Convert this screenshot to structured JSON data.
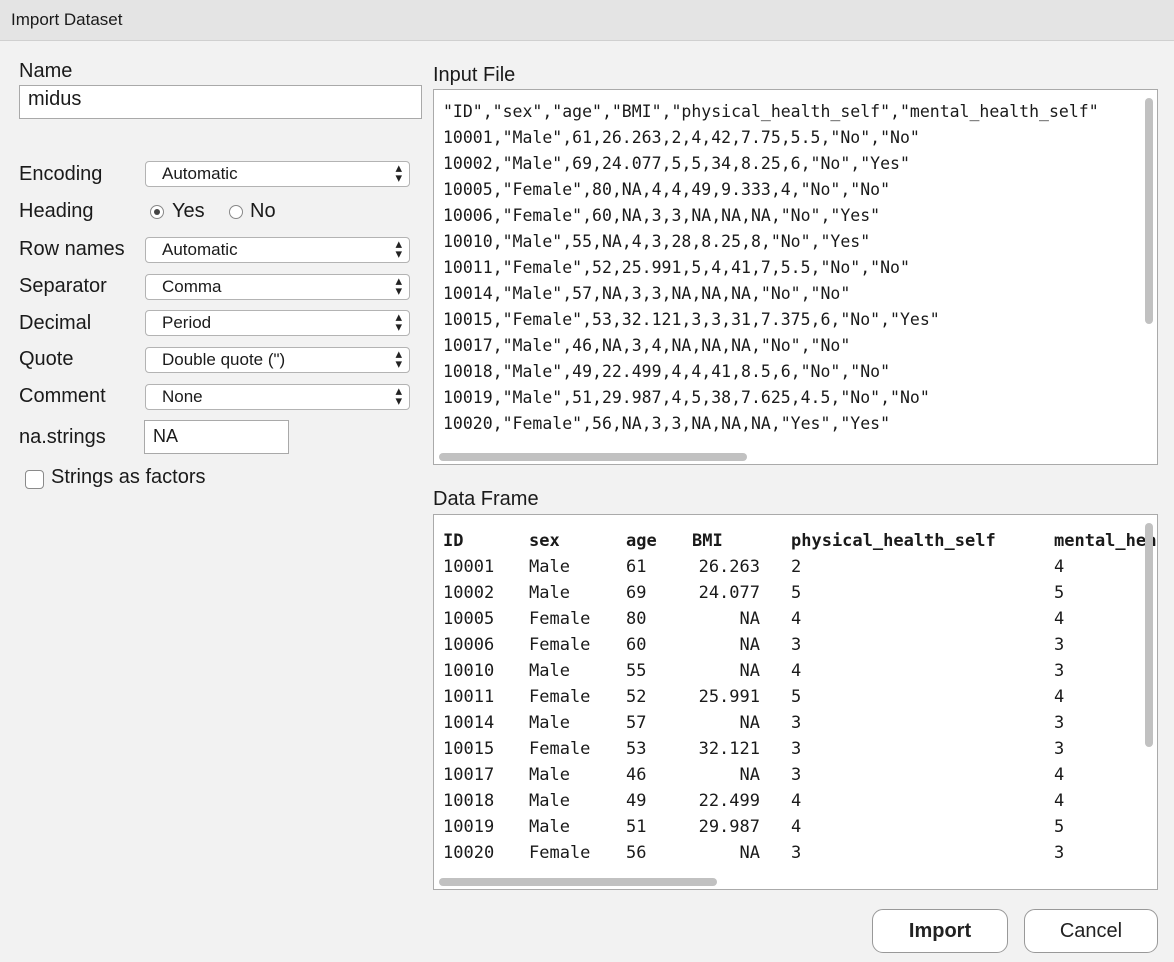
{
  "window": {
    "title": "Import Dataset"
  },
  "name": {
    "label": "Name",
    "value": "midus"
  },
  "options": {
    "encoding": {
      "label": "Encoding",
      "value": "Automatic"
    },
    "heading": {
      "label": "Heading",
      "yes": "Yes",
      "no": "No",
      "selected": "Yes"
    },
    "row_names": {
      "label": "Row names",
      "value": "Automatic"
    },
    "separator": {
      "label": "Separator",
      "value": "Comma"
    },
    "decimal": {
      "label": "Decimal",
      "value": "Period"
    },
    "quote": {
      "label": "Quote",
      "value": "Double quote (\")"
    },
    "comment": {
      "label": "Comment",
      "value": "None"
    },
    "na_strings": {
      "label": "na.strings",
      "value": "NA"
    },
    "strings_as_factors": {
      "label": "Strings as factors",
      "checked": false
    }
  },
  "input_file": {
    "label": "Input File",
    "lines": [
      "\"ID\",\"sex\",\"age\",\"BMI\",\"physical_health_self\",\"mental_health_self\"",
      "10001,\"Male\",61,26.263,2,4,42,7.75,5.5,\"No\",\"No\"",
      "10002,\"Male\",69,24.077,5,5,34,8.25,6,\"No\",\"Yes\"",
      "10005,\"Female\",80,NA,4,4,49,9.333,4,\"No\",\"No\"",
      "10006,\"Female\",60,NA,3,3,NA,NA,NA,\"No\",\"Yes\"",
      "10010,\"Male\",55,NA,4,3,28,8.25,8,\"No\",\"Yes\"",
      "10011,\"Female\",52,25.991,5,4,41,7,5.5,\"No\",\"No\"",
      "10014,\"Male\",57,NA,3,3,NA,NA,NA,\"No\",\"No\"",
      "10015,\"Female\",53,32.121,3,3,31,7.375,6,\"No\",\"Yes\"",
      "10017,\"Male\",46,NA,3,4,NA,NA,NA,\"No\",\"No\"",
      "10018,\"Male\",49,22.499,4,4,41,8.5,6,\"No\",\"No\"",
      "10019,\"Male\",51,29.987,4,5,38,7.625,4.5,\"No\",\"No\"",
      "10020,\"Female\",56,NA,3,3,NA,NA,NA,\"Yes\",\"Yes\""
    ]
  },
  "data_frame": {
    "label": "Data Frame",
    "columns": [
      "ID",
      "sex",
      "age",
      "BMI",
      "physical_health_self",
      "mental_health_self"
    ],
    "rows": [
      [
        "10001",
        "Male",
        "61",
        "26.263",
        "2",
        "4"
      ],
      [
        "10002",
        "Male",
        "69",
        "24.077",
        "5",
        "5"
      ],
      [
        "10005",
        "Female",
        "80",
        "NA",
        "4",
        "4"
      ],
      [
        "10006",
        "Female",
        "60",
        "NA",
        "3",
        "3"
      ],
      [
        "10010",
        "Male",
        "55",
        "NA",
        "4",
        "3"
      ],
      [
        "10011",
        "Female",
        "52",
        "25.991",
        "5",
        "4"
      ],
      [
        "10014",
        "Male",
        "57",
        "NA",
        "3",
        "3"
      ],
      [
        "10015",
        "Female",
        "53",
        "32.121",
        "3",
        "3"
      ],
      [
        "10017",
        "Male",
        "46",
        "NA",
        "3",
        "4"
      ],
      [
        "10018",
        "Male",
        "49",
        "22.499",
        "4",
        "4"
      ],
      [
        "10019",
        "Male",
        "51",
        "29.987",
        "4",
        "5"
      ],
      [
        "10020",
        "Female",
        "56",
        "NA",
        "3",
        "3"
      ]
    ]
  },
  "buttons": {
    "import": "Import",
    "cancel": "Cancel"
  },
  "icons": {
    "select_arrows": "updown-chevron-icon"
  }
}
